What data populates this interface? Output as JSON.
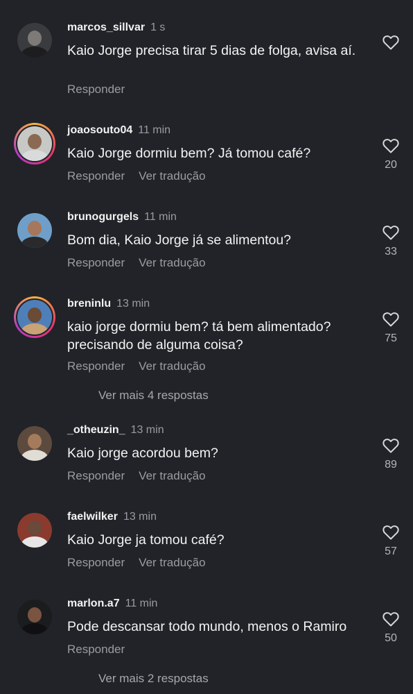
{
  "actions": {
    "reply": "Responder",
    "translate": "Ver tradução"
  },
  "colors": {
    "background": "#212328",
    "secondary_text": "#9a9ca1",
    "story_ring": [
      "#f9b43a",
      "#e6336b",
      "#b63cc6"
    ]
  },
  "comments": [
    {
      "username": "marcos_sillvar",
      "time": "1 s",
      "text": "Kaio Jorge precisa tirar 5 dias de folga, avisa aí.",
      "likes": "",
      "show_translate": false,
      "story_ring": false
    },
    {
      "username": "joaosouto04",
      "time": "11 min",
      "text": "Kaio Jorge dormiu bem? Já tomou café?",
      "likes": "20",
      "show_translate": true,
      "story_ring": true
    },
    {
      "username": "brunogurgels",
      "time": "11 min",
      "text": "Bom dia, Kaio Jorge já se alimentou?",
      "likes": "33",
      "show_translate": true,
      "story_ring": false
    },
    {
      "username": "breninlu",
      "time": "13 min",
      "text": "kaio jorge dormiu bem? tá bem alimentado? precisando de alguma coisa?",
      "likes": "75",
      "show_translate": true,
      "story_ring": true,
      "more_replies": "Ver mais 4 respostas"
    },
    {
      "username": "_otheuzin_",
      "time": "13 min",
      "text": "Kaio jorge acordou bem?",
      "likes": "89",
      "show_translate": true,
      "story_ring": false
    },
    {
      "username": "faelwilker",
      "time": "13 min",
      "text": "Kaio Jorge ja tomou café?",
      "likes": "57",
      "show_translate": true,
      "story_ring": false
    },
    {
      "username": "marlon.a7",
      "time": "11 min",
      "text": "Pode descansar todo mundo, menos o Ramiro",
      "likes": "50",
      "show_translate": false,
      "story_ring": false,
      "more_replies": "Ver mais 2 respostas"
    }
  ]
}
